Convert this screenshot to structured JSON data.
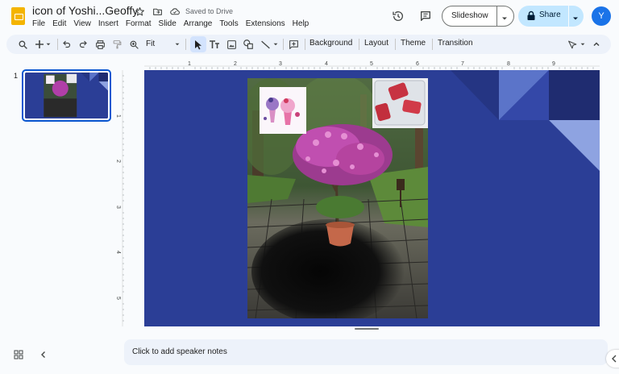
{
  "header": {
    "title": "icon of Yoshi...Geoffy",
    "saved_status": "Saved to Drive",
    "menu": [
      "File",
      "Edit",
      "View",
      "Insert",
      "Format",
      "Slide",
      "Arrange",
      "Tools",
      "Extensions",
      "Help"
    ],
    "slideshow_label": "Slideshow",
    "share_label": "Share",
    "avatar_initial": "Y"
  },
  "toolbar": {
    "zoom_value": "Fit",
    "background_label": "Background",
    "layout_label": "Layout",
    "theme_label": "Theme",
    "transition_label": "Transition"
  },
  "filmstrip": {
    "slide_number": "1"
  },
  "rulers": {
    "horizontal_ticks": [
      "1",
      "2",
      "3",
      "4",
      "5",
      "6",
      "7",
      "8",
      "9"
    ],
    "vertical_ticks": [
      "1",
      "2",
      "3",
      "4",
      "5"
    ]
  },
  "notes": {
    "placeholder": "Click to add speaker notes"
  },
  "colors": {
    "slide_background": "#2b3e96",
    "accent_blue": "#0b57d0",
    "share_button": "#c2e7ff",
    "avatar": "#1a73e8",
    "app_logo": "#f4b400"
  }
}
